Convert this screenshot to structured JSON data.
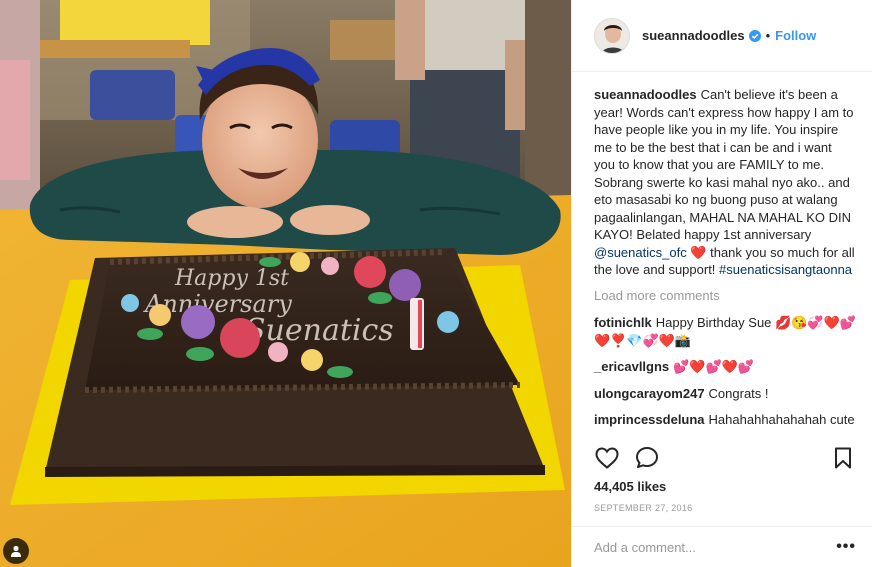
{
  "post": {
    "username": "sueannadoodles",
    "follow_label": "Follow",
    "separator": "•",
    "caption": {
      "username": "sueannadoodles",
      "text": "Can't believe it's been a year! Words can't express how happy I am to have people like you in my life. You inspire me to be the best that i can be and i want you to know that you are FAMILY to me. Sobrang swerte ko kasi mahal nyo ako.. and eto masasabi ko ng buong puso at walang pagaalinlangan, MAHAL NA MAHAL KO DIN KAYO! Belated happy 1st anniversary ",
      "mention": "@suenatics_ofc",
      "text_after": " ❤️ thank you so much for all the love and support!",
      "hashtag": "#suenaticsisangtaonna"
    },
    "load_more_label": "Load more comments",
    "comments": [
      {
        "username": "fotinichlk",
        "text": "Happy Birthday Sue 💋😘💞❤️💕 ❤️❣️💎💞❤️📸"
      },
      {
        "username": "_ericavllgns",
        "text": "💕❤️💕❤️💕"
      },
      {
        "username": "ulongcarayom247",
        "text": "Congrats !"
      },
      {
        "username": "imprincessdeluna",
        "text": "Hahahahhahahahah cute"
      }
    ],
    "likes": "44,405 likes",
    "date": "SEPTEMBER 27, 2016",
    "add_comment_placeholder": "Add a comment...",
    "more_label": "•••"
  },
  "photo": {
    "cake_text_line1": "Happy 1st",
    "cake_text_line2": "Anniversary",
    "cake_text_line3": "Suenatics"
  },
  "icons": {
    "like": "heart-icon",
    "comment": "comment-bubble-icon",
    "save": "bookmark-icon",
    "verified": "verified-badge-icon",
    "user_tag": "person-icon"
  }
}
